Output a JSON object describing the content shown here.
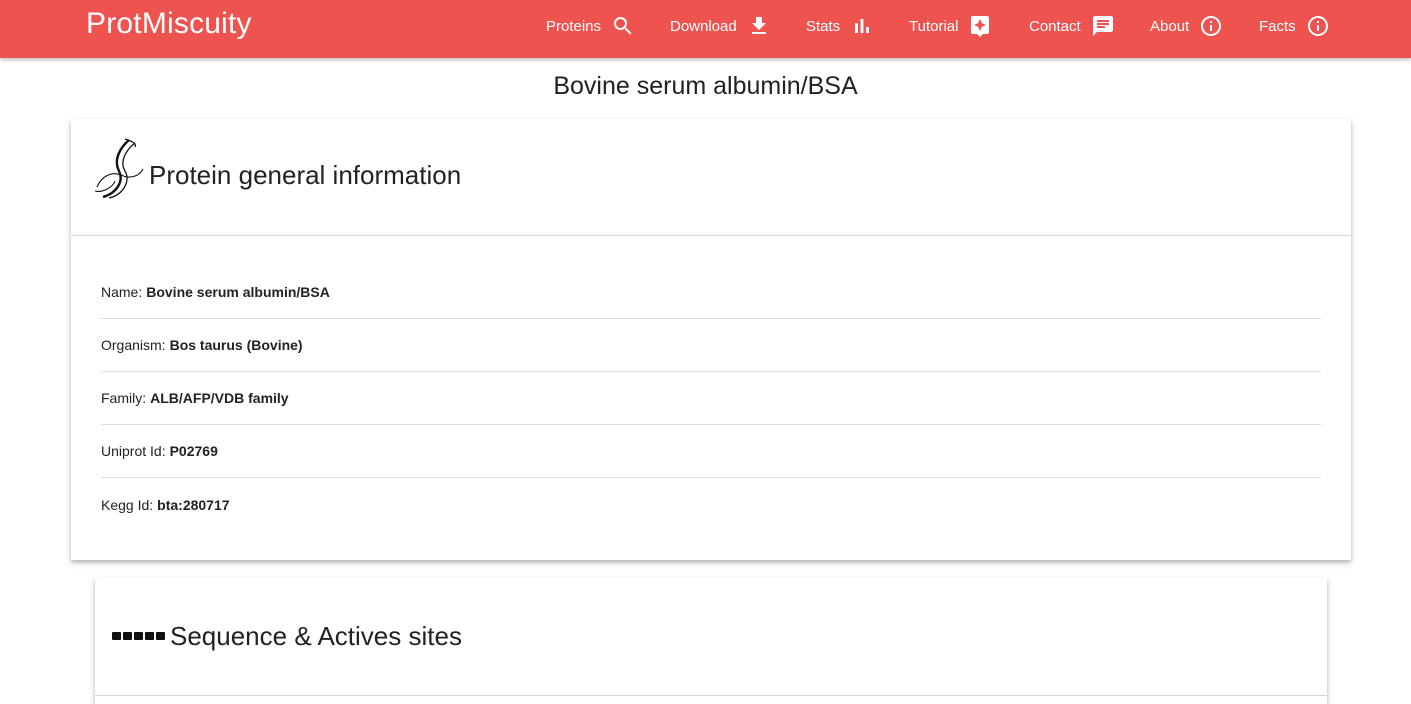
{
  "theme": {
    "nav_bg": "#ef5350"
  },
  "navbar": {
    "brand": "ProtMiscuity",
    "items": [
      {
        "label": "Proteins",
        "icon": "search-icon"
      },
      {
        "label": "Download",
        "icon": "download-icon"
      },
      {
        "label": "Stats",
        "icon": "bar-chart-icon"
      },
      {
        "label": "Tutorial",
        "icon": "sparkle-box-icon"
      },
      {
        "label": "Contact",
        "icon": "chat-icon"
      },
      {
        "label": "About",
        "icon": "info-icon"
      },
      {
        "label": "Facts",
        "icon": "info-icon"
      }
    ]
  },
  "page": {
    "title": "Bovine serum albumin/BSA"
  },
  "general_card": {
    "title": "Protein general information",
    "icon": "protein-ribbon-icon",
    "rows": [
      {
        "label": "Name:",
        "value": "Bovine serum albumin/BSA"
      },
      {
        "label": "Organism:",
        "value": "Bos taurus (Bovine)"
      },
      {
        "label": "Family:",
        "value": "ALB/AFP/VDB family"
      },
      {
        "label": "Uniprot Id:",
        "value": "P02769"
      },
      {
        "label": "Kegg Id:",
        "value": "bta:280717"
      }
    ]
  },
  "sequence_card": {
    "title": "Sequence & Actives sites",
    "icon": "sequence-blocks-icon"
  }
}
